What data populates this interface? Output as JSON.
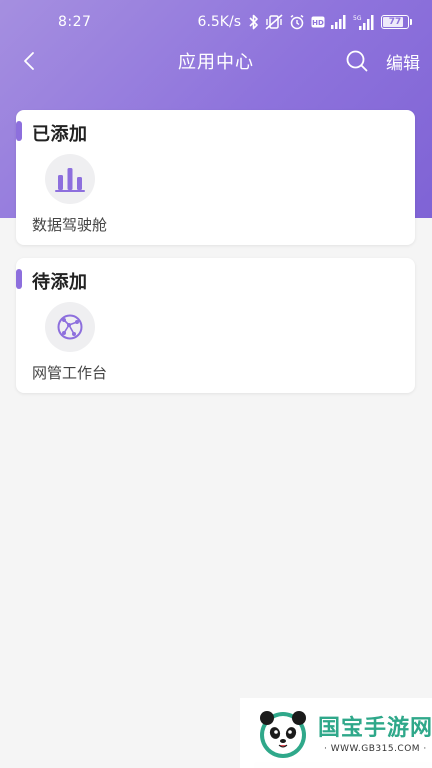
{
  "status_bar": {
    "time": "8:27",
    "network_speed": "6.5K/s",
    "battery_level": "77",
    "battery_fraction": 0.77,
    "network_type": "5G",
    "icons": [
      "bluetooth-icon",
      "vibrate-off-icon",
      "alarm-icon",
      "hd-icon",
      "signal-icon",
      "signal-5g-icon",
      "battery-icon"
    ]
  },
  "navbar": {
    "title": "应用中心",
    "edit_label": "编辑",
    "back_icon": "chevron-left-icon",
    "search_icon": "search-icon"
  },
  "sections": {
    "added": {
      "title": "已添加",
      "apps": [
        {
          "label": "数据驾驶舱",
          "icon": "bar-chart-icon"
        }
      ]
    },
    "pending": {
      "title": "待添加",
      "apps": [
        {
          "label": "网管工作台",
          "icon": "network-globe-icon"
        }
      ]
    }
  },
  "watermark": {
    "brand": "国宝手游网",
    "url": "· WWW.GB315.COM ·"
  },
  "colors": {
    "accent": "#8d6fdd",
    "header_gradient_start": "#a58fe0",
    "header_gradient_end": "#7f63d5",
    "background": "#f5f5f5",
    "watermark_brand": "#2fa88a"
  }
}
